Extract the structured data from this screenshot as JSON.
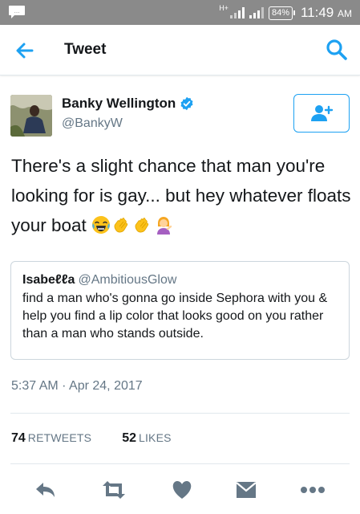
{
  "status_bar": {
    "network": "H+",
    "battery": "84%",
    "time": "11:49",
    "ampm": "AM"
  },
  "header": {
    "title": "Tweet",
    "back_icon": "arrow-left-icon",
    "search_icon": "search-icon"
  },
  "author": {
    "name": "Banky Wellington",
    "handle": "@BankyW",
    "verified": true
  },
  "tweet": {
    "text": "There's a slight chance that man you're looking for is gay... but hey whatever floats your boat",
    "emojis": [
      "face-with-tears-of-joy",
      "clapping-hands",
      "clapping-hands",
      "person-tipping-hand"
    ]
  },
  "quoted_tweet": {
    "name": "Isabeℓℓa",
    "handle": "@AmbitiousGlow",
    "text": "find a man who's gonna go inside Sephora with you & help you find a lip color that looks good on you rather than a man who stands outside."
  },
  "timestamp": "5:37 AM · Apr 24, 2017",
  "stats": {
    "retweets_count": "74",
    "retweets_label": "RETWEETS",
    "likes_count": "52",
    "likes_label": "LIKES"
  },
  "colors": {
    "accent": "#1da1f2",
    "status_bar": "#8a8a8a",
    "action_icons": "#657786"
  }
}
